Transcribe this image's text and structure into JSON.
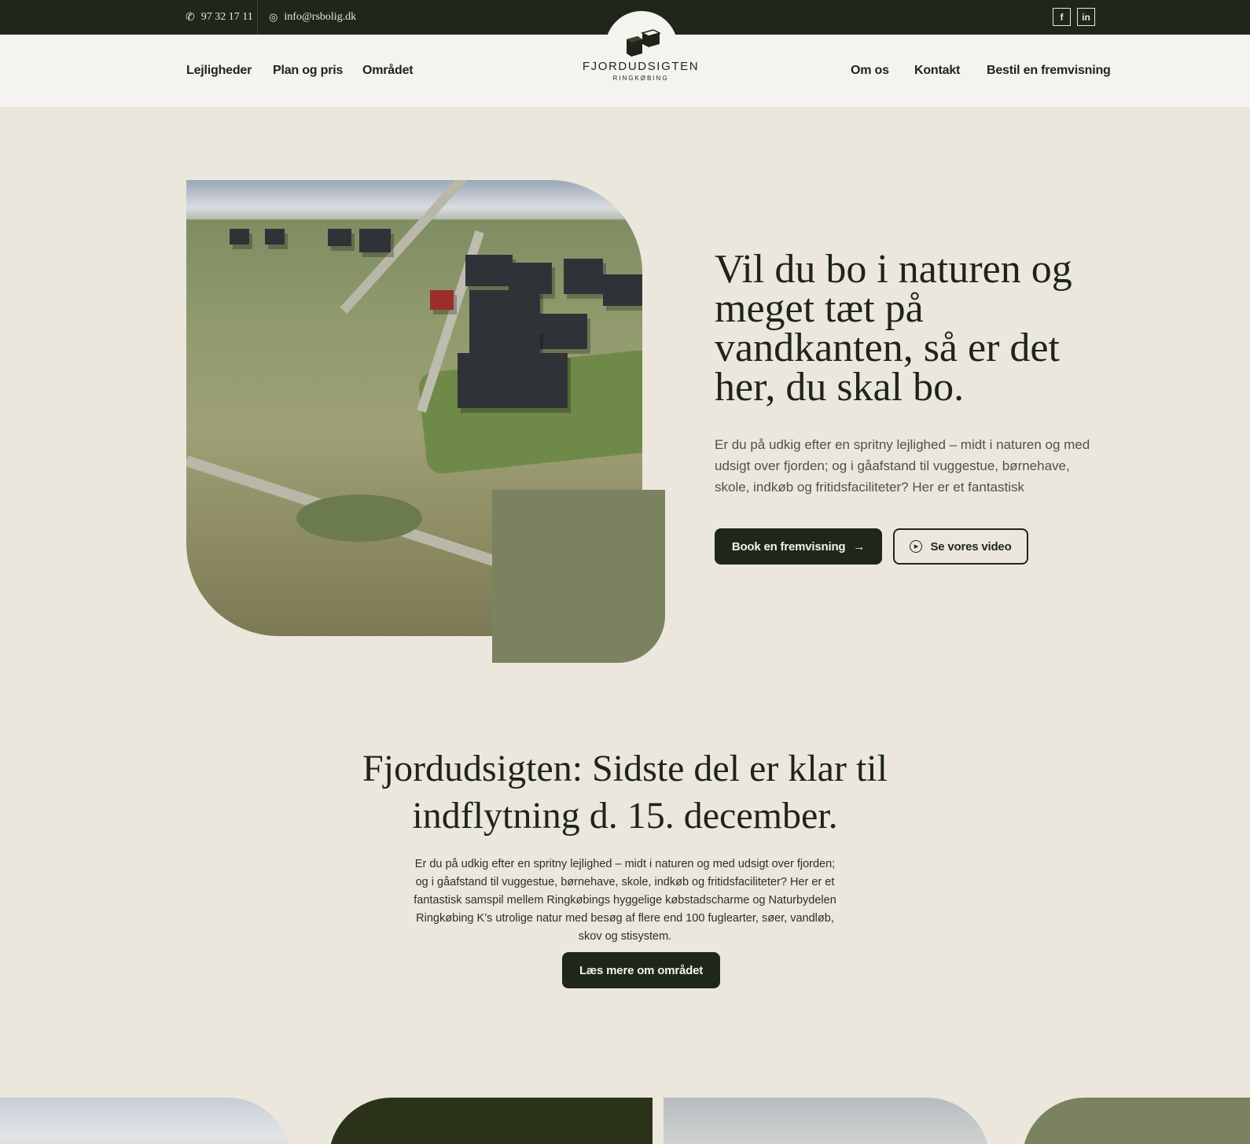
{
  "topbar": {
    "phone": "97 32 17 11",
    "email": "info@rsbolig.dk",
    "social": [
      {
        "label": "f",
        "icon": "facebook-icon"
      },
      {
        "label": "in",
        "icon": "linkedin-icon"
      }
    ]
  },
  "nav": {
    "left": [
      "Lejligheder",
      "Plan og pris",
      "Området"
    ],
    "right": [
      "Om os",
      "Kontakt",
      "Bestil en fremvisning"
    ]
  },
  "logo": {
    "brand": "FJORDUDSIGTEN",
    "sub": "RINGKØBING"
  },
  "hero": {
    "title": "Vil du bo i naturen og meget tæt på vandkanten, så er det her, du skal bo.",
    "text": "Er du på udkig efter en spritny lejlighed – midt i naturen og med udsigt over fjorden; og i gåafstand til vuggestue, børnehave, skole, indkøb og fritidsfaciliteter? Her er et fantastisk",
    "btn_primary": "Book en fremvisning",
    "btn_secondary": "Se vores video"
  },
  "section": {
    "title": "Fjordudsigten: Sidste del er klar til indflytning d. 15. december.",
    "text": "Er du på udkig efter en spritny lejlighed – midt i naturen og med udsigt over fjorden; og i gåafstand til vuggestue, børnehave, skole, indkøb og fritidsfaciliteter? Her er et fantastisk samspil mellem Ringkøbings hyggelige købstadscharme og Naturbydelen Ringkøbing K’s utrolige natur med besøg af flere end 100 fuglearter, søer, vandløb, skov og stisystem.",
    "button": "Læs mere om området"
  },
  "colors": {
    "dark": "#1e2719",
    "olive": "#7b8260",
    "background": "#ebe7dc"
  }
}
